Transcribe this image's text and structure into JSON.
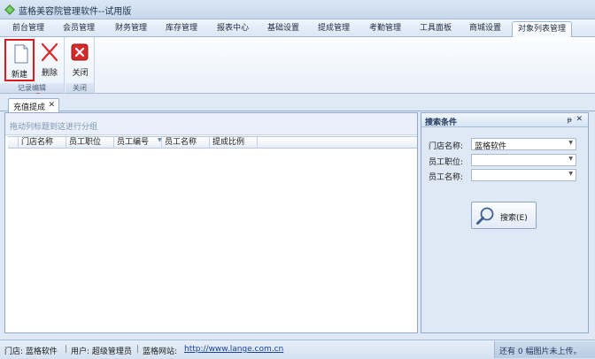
{
  "app": {
    "title": "蓝格美容院管理软件--试用版"
  },
  "menu": {
    "tabs": [
      {
        "label": "前台管理",
        "active": false
      },
      {
        "label": "会员管理",
        "active": false
      },
      {
        "label": "财务管理",
        "active": false
      },
      {
        "label": "库存管理",
        "active": false
      },
      {
        "label": "报表中心",
        "active": false
      },
      {
        "label": "基础设置",
        "active": false
      },
      {
        "label": "提成管理",
        "active": false
      },
      {
        "label": "考勤管理",
        "active": false
      },
      {
        "label": "工具面板",
        "active": false
      },
      {
        "label": "商城设置",
        "active": false
      },
      {
        "label": "对象列表管理",
        "active": true
      }
    ]
  },
  "ribbon": {
    "record_group": {
      "label": "记录编辑",
      "new_label": "新建",
      "delete_label": "删除"
    },
    "close_group": {
      "label": "关闭",
      "close_label": "关闭"
    }
  },
  "doc_tab": {
    "label": "充值提成"
  },
  "grid": {
    "group_hint": "拖动列标题到这进行分组",
    "columns": [
      "门店名称",
      "员工职位",
      "员工编号",
      "员工名称",
      "提成比例"
    ]
  },
  "search_panel": {
    "title": "搜索条件",
    "fields": [
      {
        "label": "门店名称:",
        "value": "蓝格软件"
      },
      {
        "label": "员工职位:",
        "value": ""
      },
      {
        "label": "员工名称:",
        "value": ""
      }
    ],
    "search_label": "搜索(E)"
  },
  "status": {
    "store": "门店: 蓝格软件",
    "user": "用户: 超级管理员",
    "site_label": "蓝格网站:",
    "site_url": "http://www.lange.com.cn",
    "upload_notice": "还有 0 幅图片未上传。"
  },
  "colors": {
    "close_icon_red": "#d42a2a",
    "selection_outline": "#e0181b",
    "link_blue": "#1a3ea0"
  }
}
